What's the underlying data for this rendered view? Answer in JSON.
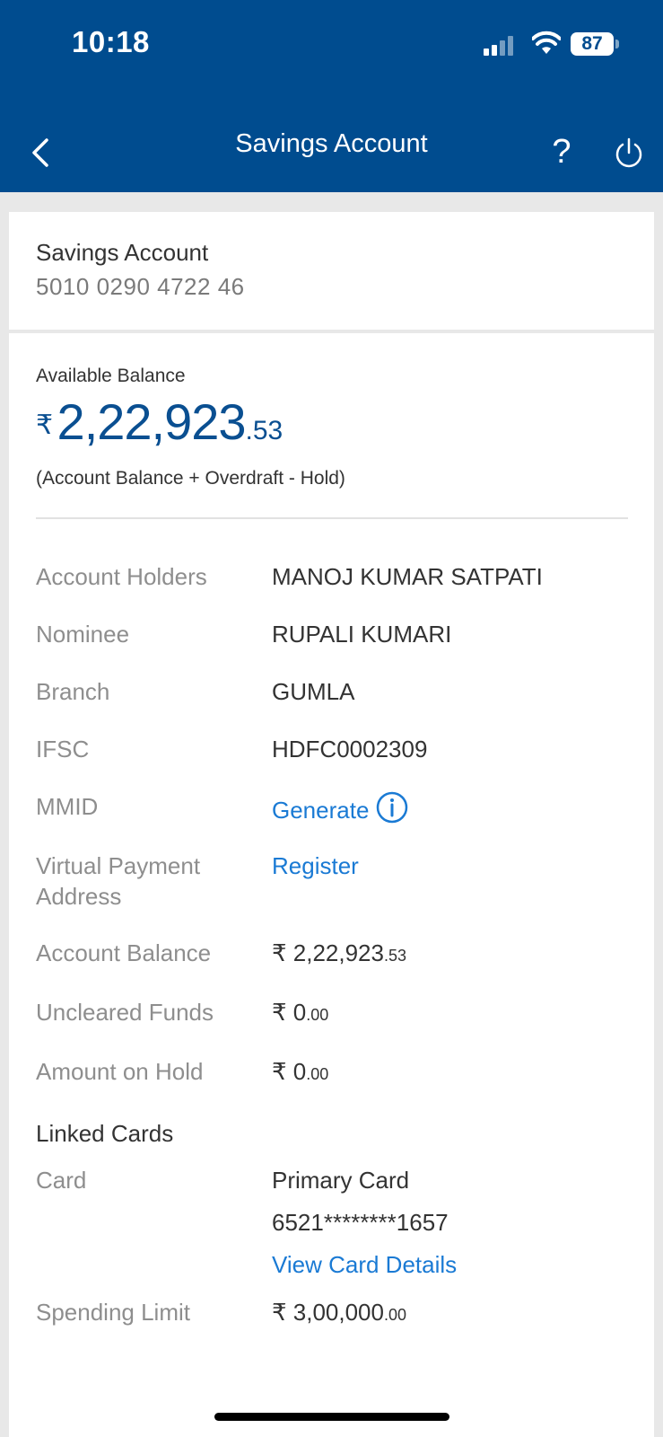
{
  "status_bar": {
    "time": "10:18",
    "battery": "87"
  },
  "nav": {
    "title": "Savings Account",
    "help": "?"
  },
  "account": {
    "name": "Savings Account",
    "number": "5010 0290 4722 46"
  },
  "balance": {
    "label": "Available Balance",
    "currency": "₹",
    "integer": "2,22,923",
    "decimal": ".53",
    "note": "(Account Balance + Overdraft - Hold)"
  },
  "details": {
    "account_holders_label": "Account Holders",
    "account_holders_value": "MANOJ KUMAR SATPATI",
    "nominee_label": "Nominee",
    "nominee_value": "RUPALI KUMARI",
    "branch_label": "Branch",
    "branch_value": "GUMLA",
    "ifsc_label": "IFSC",
    "ifsc_value": "HDFC0002309",
    "mmid_label": "MMID",
    "mmid_action": "Generate",
    "vpa_label_line1": "Virtual Payment",
    "vpa_label_line2": "Address",
    "vpa_action": "Register",
    "account_balance_label": "Account Balance",
    "account_balance_int": "₹ 2,22,923",
    "account_balance_dec": ".53",
    "uncleared_label": "Uncleared Funds",
    "uncleared_int": "₹ 0",
    "uncleared_dec": ".00",
    "hold_label": "Amount on Hold",
    "hold_int": "₹ 0",
    "hold_dec": ".00"
  },
  "linked_cards": {
    "title": "Linked Cards",
    "card_label": "Card",
    "card_type": "Primary Card",
    "card_number": "6521********1657",
    "view_details": "View Card Details",
    "spending_label": "Spending Limit",
    "spending_int": "₹ 3,00,000",
    "spending_dec": ".00"
  },
  "colors": {
    "header": "#004c8f",
    "balance": "#0a4f91",
    "link": "#1a7ad4"
  }
}
